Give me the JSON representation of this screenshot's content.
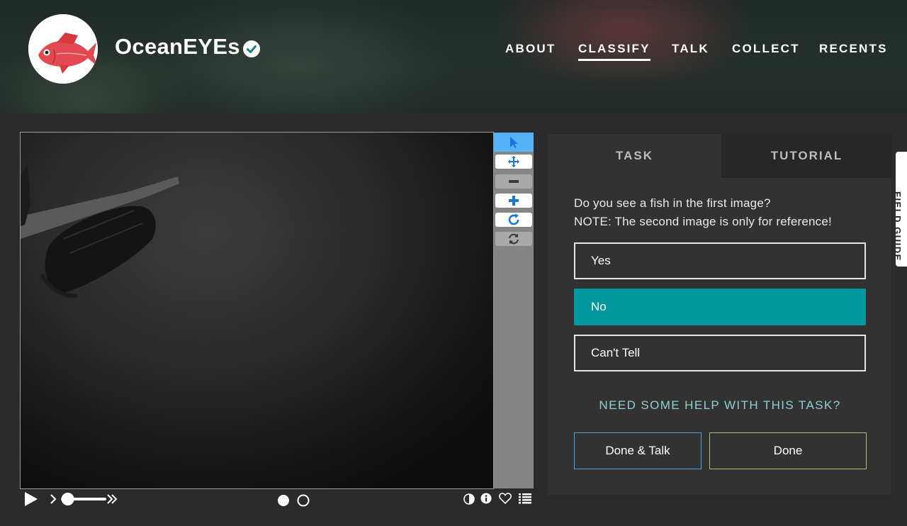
{
  "header": {
    "project_title": "OceanEYEs",
    "nav": [
      {
        "label": "ABOUT",
        "active": false
      },
      {
        "label": "CLASSIFY",
        "active": true
      },
      {
        "label": "TALK",
        "active": false
      },
      {
        "label": "COLLECT",
        "active": false
      },
      {
        "label": "RECENTS",
        "active": false
      }
    ]
  },
  "viewer": {
    "toolbar": [
      {
        "icon": "pointer-icon",
        "selected": true
      },
      {
        "icon": "move-icon"
      },
      {
        "icon": "zoom-out-icon"
      },
      {
        "icon": "zoom-in-icon"
      },
      {
        "icon": "rotate-icon"
      },
      {
        "icon": "reset-icon"
      }
    ],
    "frame_slider_level": 0.15,
    "frames": {
      "count": 2,
      "current": 1
    }
  },
  "task": {
    "tabs": {
      "task": "TASK",
      "tutorial": "TUTORIAL"
    },
    "question_line1": "Do you see a fish in the first image?",
    "question_line2": "NOTE: The second image is only for reference!",
    "answers": [
      {
        "label": "Yes",
        "selected": false
      },
      {
        "label": "No",
        "selected": true
      },
      {
        "label": "Can't Tell",
        "selected": false
      }
    ],
    "help_link": "NEED SOME HELP WITH THIS TASK?",
    "done_talk_label": "Done & Talk",
    "done_label": "Done"
  },
  "field_guide": {
    "label": "FIELD GUIDE"
  },
  "colors": {
    "accent_teal": "#00979d",
    "toolbar_selected": "#55b2f7",
    "done_border": "#a6cb64",
    "done_talk_border": "#4aa3df"
  }
}
